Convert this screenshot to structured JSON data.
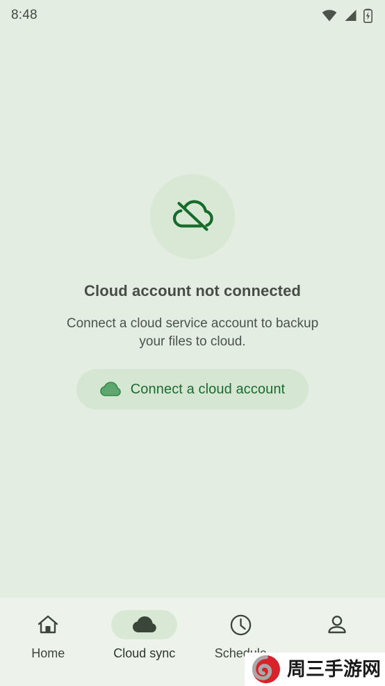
{
  "status_bar": {
    "time": "8:48",
    "icons": [
      "wifi-icon",
      "cellular-signal-icon",
      "battery-charging-icon"
    ]
  },
  "main": {
    "illustration_icon": "cloud-off-icon",
    "title": "Cloud account not connected",
    "subtitle": "Connect a cloud service account to backup your files to cloud.",
    "primary_button": {
      "icon": "cloud-icon",
      "label": "Connect a cloud account"
    }
  },
  "bottom_nav": {
    "items": [
      {
        "label": "Home",
        "icon": "home-icon",
        "active": false
      },
      {
        "label": "Cloud sync",
        "icon": "cloud-icon",
        "active": true
      },
      {
        "label": "Schedule",
        "icon": "clock-icon",
        "active": false
      },
      {
        "label": "",
        "icon": "person-icon",
        "active": false
      }
    ]
  },
  "watermark": {
    "text": "周三手游网",
    "logo_icon": "spiral-logo-icon"
  },
  "colors": {
    "background": "#e4ede2",
    "nav_background": "#edf3ea",
    "accent_green": "#1b6b30",
    "container_green": "#d8e8d5",
    "button_green": "#d5e7d2",
    "text_primary": "#454d44",
    "icon_dark": "#3d443c",
    "watermark_red": "#d8232a"
  }
}
